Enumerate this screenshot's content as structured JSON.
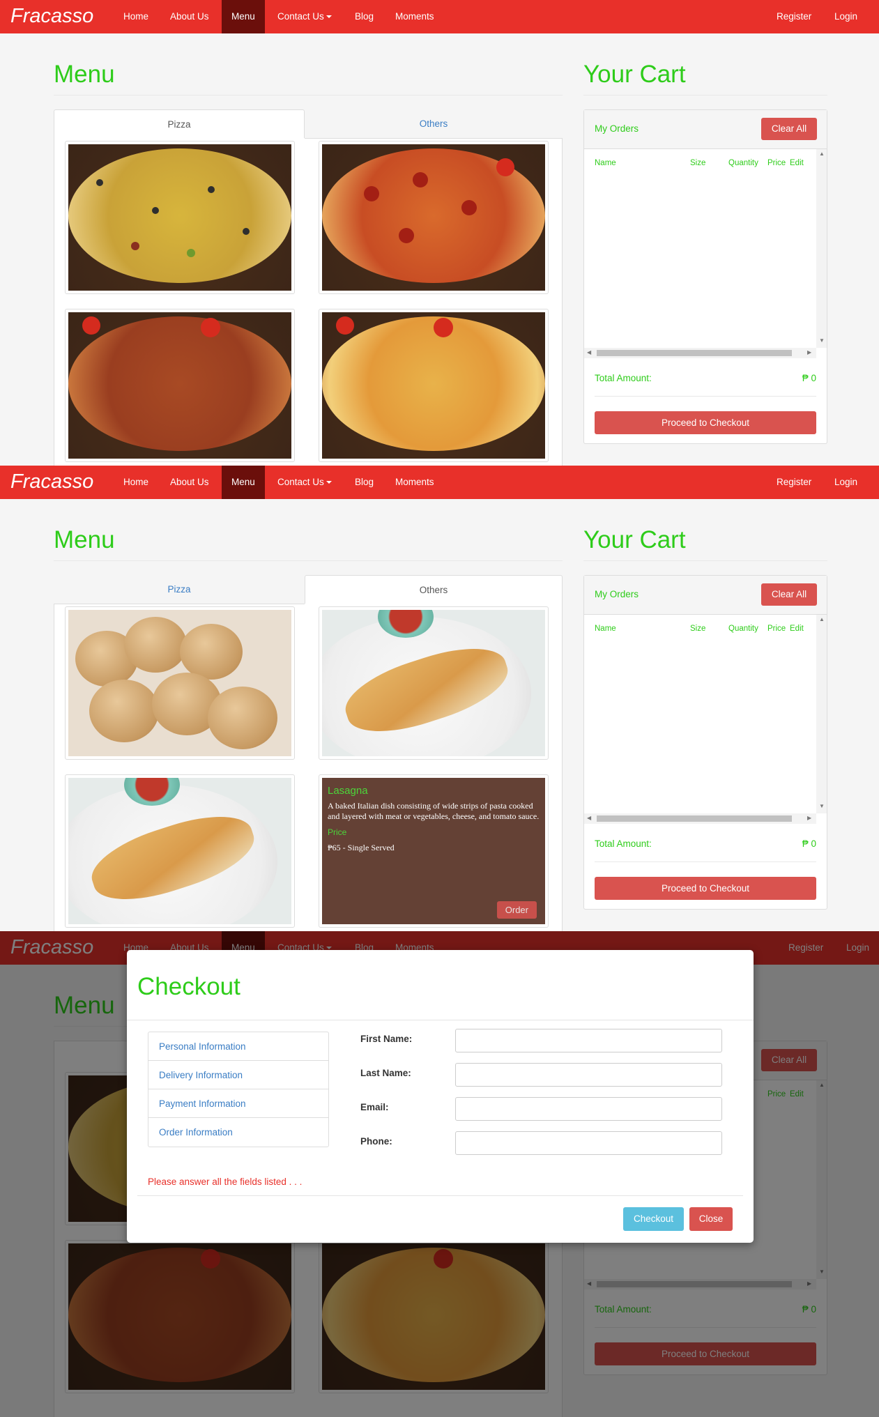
{
  "nav": {
    "brand": "Fracasso",
    "items": [
      "Home",
      "About Us",
      "Menu",
      "Contact Us",
      "Blog",
      "Moments"
    ],
    "register": "Register",
    "login": "Login"
  },
  "menu": {
    "title": "Menu",
    "tabs": [
      "Pizza",
      "Others"
    ]
  },
  "lasagna": {
    "name": "Lasagna",
    "description": "A baked Italian dish consisting of wide strips of pasta cooked and layered with meat or vegetables, cheese, and tomato sauce.",
    "price_label": "Price",
    "price": "₱65 - Single Served",
    "order_label": "Order"
  },
  "cart": {
    "title": "Your Cart",
    "orders_label": "My Orders",
    "clear_all": "Clear All",
    "columns": [
      "Name",
      "Size",
      "Quantity",
      "Price",
      "Edit"
    ],
    "total_label": "Total Amount:",
    "total_value": "₱ 0",
    "checkout_label": "Proceed to Checkout"
  },
  "modal": {
    "title": "Checkout",
    "sections": [
      "Personal Information",
      "Delivery Information",
      "Payment Information",
      "Order Information"
    ],
    "warning": "Please answer all the fields listed . . .",
    "fields": [
      "First Name:",
      "Last Name:",
      "Email:",
      "Phone:"
    ],
    "checkout_button": "Checkout",
    "close_button": "Close"
  },
  "colors": {
    "nav_red": "#e8302a",
    "active_nav": "#6b0f0b",
    "heading_green": "#2ecc1a",
    "button_red": "#d9534f",
    "info_blue": "#5bc0de",
    "link_blue": "#3a7dc4"
  }
}
